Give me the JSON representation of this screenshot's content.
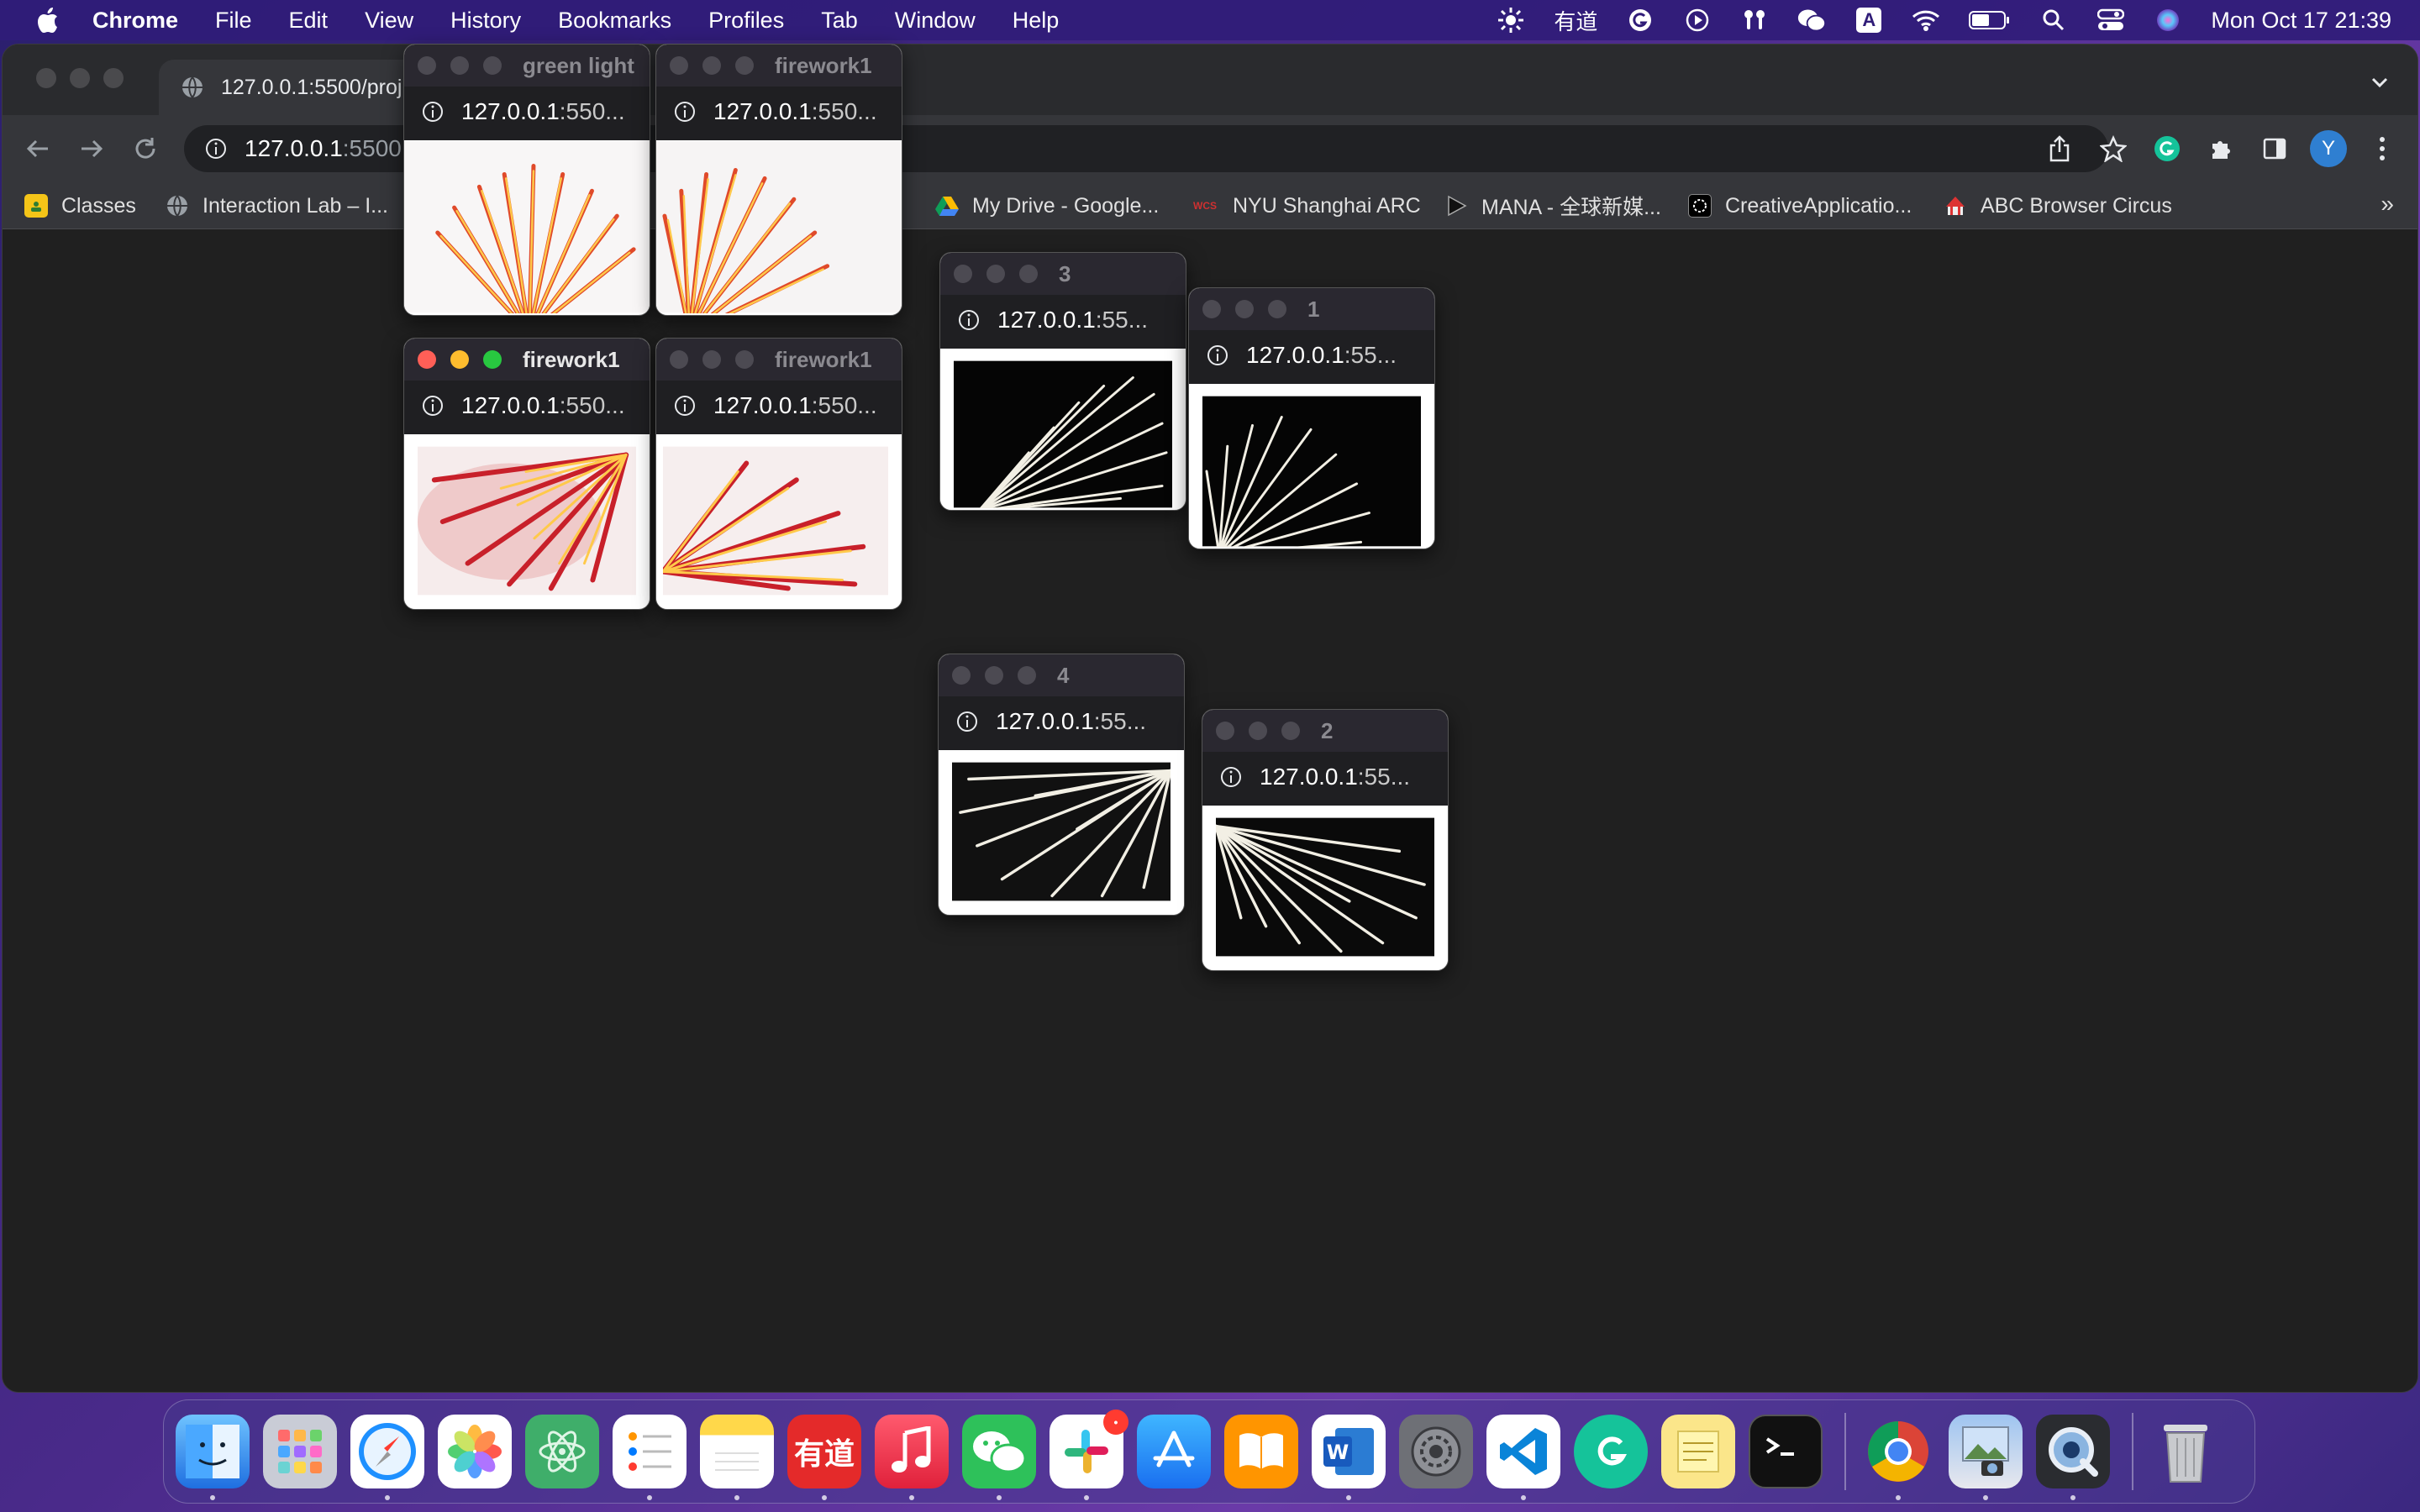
{
  "menubar": {
    "app_name": "Chrome",
    "items": [
      "File",
      "Edit",
      "View",
      "History",
      "Bookmarks",
      "Profiles",
      "Tab",
      "Window",
      "Help"
    ],
    "youdao_label": "有道",
    "input_label": "A",
    "clock": "Mon Oct 17  21:39"
  },
  "browser": {
    "tab_title": "127.0.0.1:5500/proj",
    "omnibox_host": "127.0.0.1",
    "omnibox_port": ":5500",
    "avatar_letter": "Y",
    "bookmarks": [
      "Classes",
      "Interaction Lab – I...",
      "My Drive - Google...",
      "NYU Shanghai ARC",
      "MANA - 全球新媒...",
      "CreativeApplicatio...",
      "ABC Browser Circus"
    ],
    "bookmarks_more": "»"
  },
  "popups": [
    {
      "title": "green light",
      "url_host": "127.0.0.1",
      "url_rest": ":550..."
    },
    {
      "title": "firework1",
      "url_host": "127.0.0.1",
      "url_rest": ":550..."
    },
    {
      "title": "firework1",
      "url_host": "127.0.0.1",
      "url_rest": ":550...",
      "active": true
    },
    {
      "title": "firework1",
      "url_host": "127.0.0.1",
      "url_rest": ":550..."
    },
    {
      "title": "3",
      "url_host": "127.0.0.1",
      "url_rest": ":55..."
    },
    {
      "title": "1",
      "url_host": "127.0.0.1",
      "url_rest": ":55..."
    },
    {
      "title": "4",
      "url_host": "127.0.0.1",
      "url_rest": ":55..."
    },
    {
      "title": "2",
      "url_host": "127.0.0.1",
      "url_rest": ":55..."
    }
  ],
  "dock": {
    "youdao_label": "有道",
    "word_label": "W",
    "slack_badge": "•"
  },
  "colors": {
    "accent_red": "#ff5f57",
    "accent_yellow": "#febc2e",
    "accent_green": "#28c840",
    "page_bg": "#202020"
  }
}
